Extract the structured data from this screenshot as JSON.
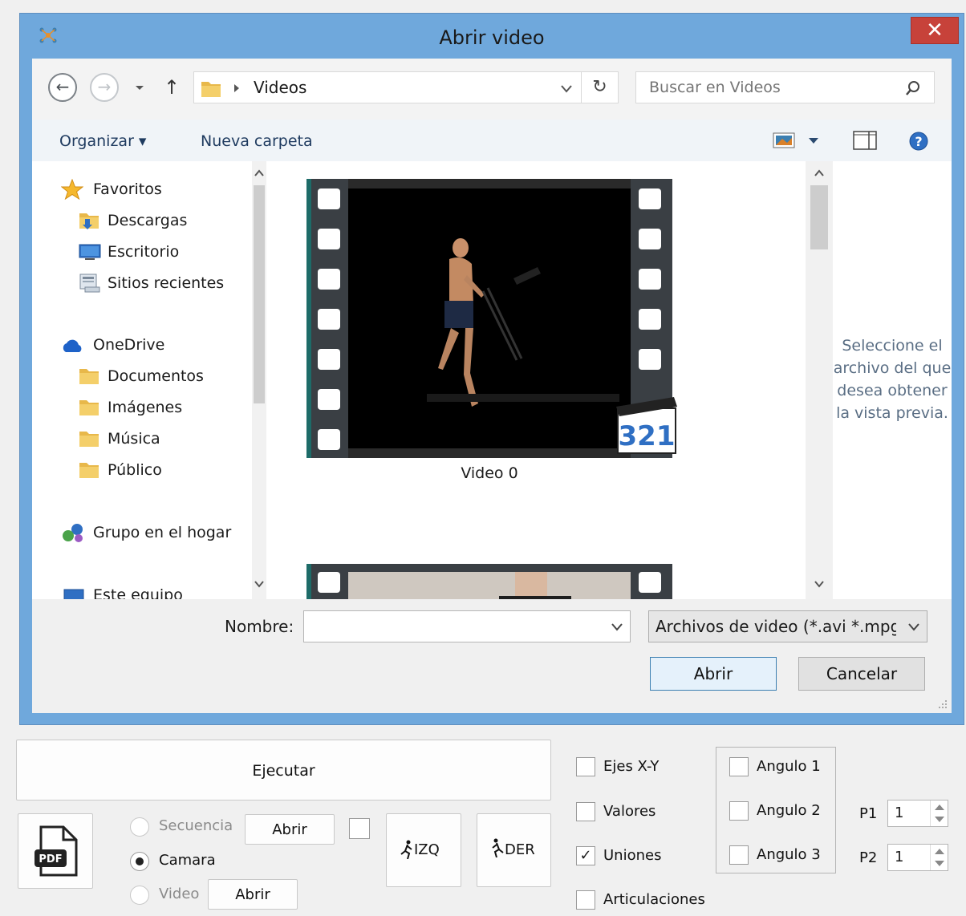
{
  "dialog": {
    "title": "Abrir video",
    "close_glyph": "✕",
    "nav": {
      "back_glyph": "←",
      "forward_glyph": "→",
      "up_glyph": "↑",
      "refresh_glyph": "↻",
      "dropdown_glyph": "⌄"
    },
    "address": {
      "path": "Videos"
    },
    "search": {
      "placeholder": "Buscar en Videos"
    },
    "toolbar": {
      "organize": "Organizar ▾",
      "new_folder": "Nueva carpeta"
    },
    "nav_pane": {
      "favorites": {
        "label": "Favoritos",
        "items": [
          "Descargas",
          "Escritorio",
          "Sitios recientes"
        ]
      },
      "onedrive": {
        "label": "OneDrive",
        "items": [
          "Documentos",
          "Imágenes",
          "Música",
          "Público"
        ]
      },
      "homegroup": "Grupo en el hogar",
      "this_pc": "Este equipo"
    },
    "files": [
      {
        "name": "Video 0"
      },
      {
        "name": ""
      }
    ],
    "preview_text": "Seleccione el archivo del que desea obtener la vista previa.",
    "filename_label": "Nombre:",
    "filename_value": "",
    "filter": "Archivos de video (*.avi *.mpg",
    "open_button": "Abrir",
    "cancel_button": "Cancelar",
    "badge_text": "321"
  },
  "app": {
    "run_button": "Ejecutar",
    "pdf_label": "PDF",
    "source_options": [
      {
        "label": "Secuencia",
        "selected": false,
        "enabled": false,
        "open_label": "Abrir"
      },
      {
        "label": "Camara",
        "selected": true,
        "enabled": true
      },
      {
        "label": "Video",
        "selected": false,
        "enabled": false,
        "open_label": "Abrir"
      }
    ],
    "left_button": "IZQ",
    "right_button": "DER",
    "checks": [
      {
        "label": "Ejes X-Y",
        "checked": false
      },
      {
        "label": "Valores",
        "checked": false
      },
      {
        "label": "Uniones",
        "checked": true
      },
      {
        "label": "Articulaciones",
        "checked": false
      }
    ],
    "angles": [
      {
        "label": "Angulo 1",
        "checked": false
      },
      {
        "label": "Angulo 2",
        "checked": false
      },
      {
        "label": "Angulo 3",
        "checked": false
      }
    ],
    "p1": {
      "label": "P1",
      "value": "1"
    },
    "p2": {
      "label": "P2",
      "value": "1"
    },
    "check_glyph": "✓"
  },
  "colors": {
    "title_bar": "#6fa8dc",
    "close": "#c7423a",
    "accent": "#3c7fb1"
  }
}
